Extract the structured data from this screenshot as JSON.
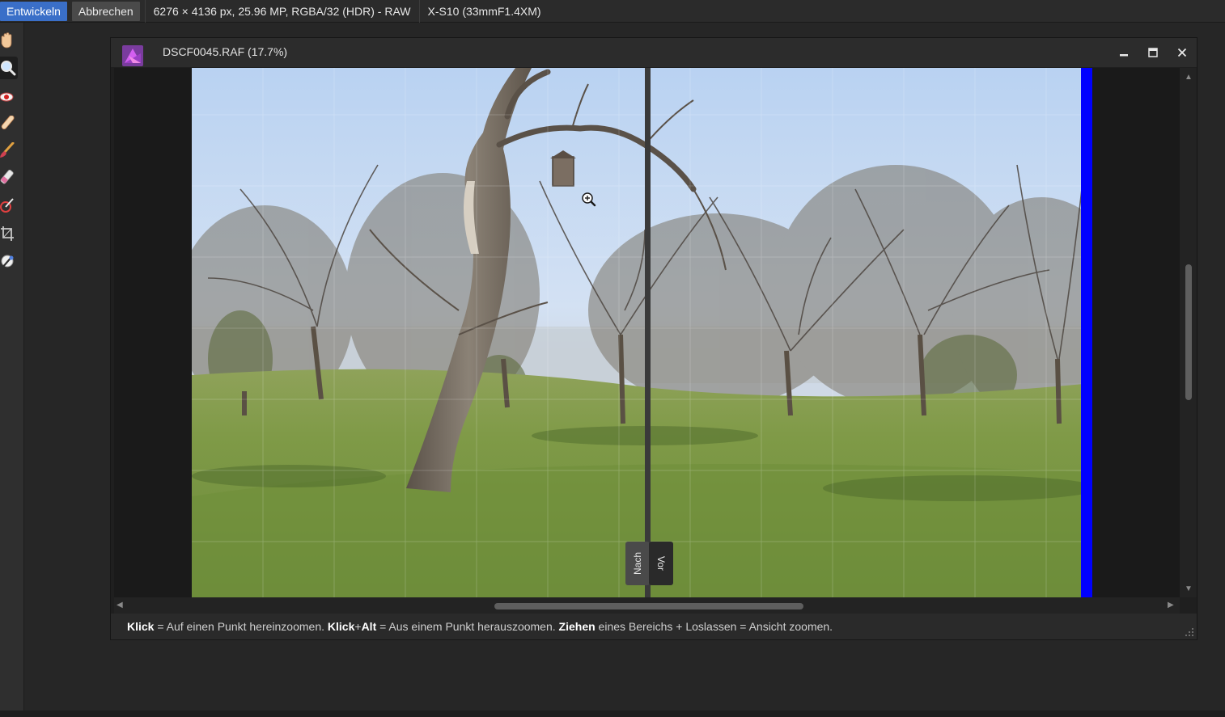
{
  "context_bar": {
    "develop_label": "Entwickeln",
    "cancel_label": "Abbrechen",
    "image_info": "6276 × 4136 px, 25.96 MP, RGBA/32 (HDR) - RAW",
    "camera_info": "X-S10 (33mmF1.4XM)"
  },
  "toolbar": {
    "tools": [
      "hand-tool",
      "zoom-tool",
      "red-eye-tool",
      "spot-repair-tool",
      "overlay-paint-tool",
      "overlay-erase-tool",
      "overlay-gradient-tool",
      "crop-tool",
      "white-balance-tool"
    ],
    "active_tool": "zoom-tool"
  },
  "document": {
    "title": "DSCF0045.RAF (17.7%)",
    "zoom_percent": 17.7
  },
  "split_view": {
    "after_label": "Nach",
    "before_label": "Vor"
  },
  "status": {
    "click_key": "Klick",
    "click_text": " = Auf einen Punkt hereinzoomen. ",
    "click_alt_key": "Klick",
    "plus": "+",
    "alt_key": "Alt",
    "click_alt_text": " = Aus einem Punkt herauszoomen. ",
    "drag_key": "Ziehen",
    "drag_text": " eines Bereichs + Loslassen = Ansicht zoomen."
  },
  "colors": {
    "accent": "#3a6fc8",
    "clipping_blue": "#0000ff",
    "app_logo": "#b75ce0"
  }
}
